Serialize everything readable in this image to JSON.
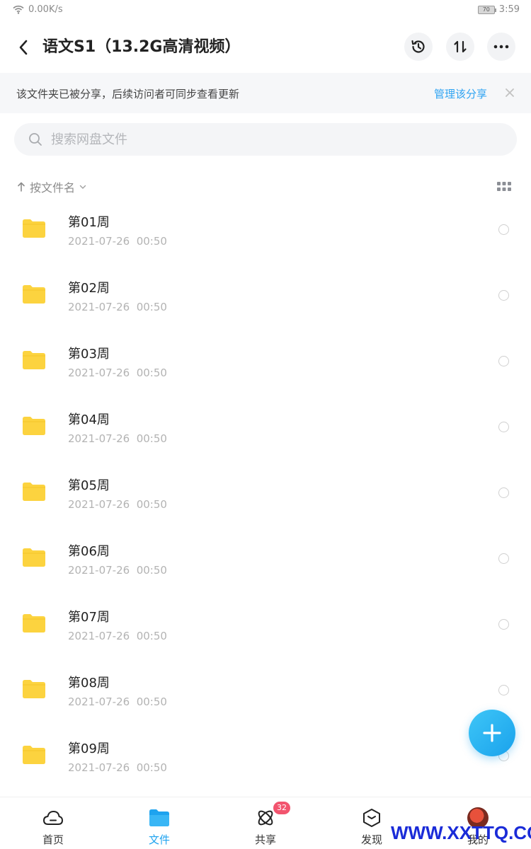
{
  "status_bar": {
    "network_speed": "0.00K/s",
    "battery": "70",
    "time": "3:59"
  },
  "header": {
    "title": "语文S1（13.2G高清视频）"
  },
  "share_notice": {
    "text": "该文件夹已被分享，后续访问者可同步查看更新",
    "manage_link": "管理该分享"
  },
  "search": {
    "placeholder": "搜索网盘文件"
  },
  "sort": {
    "label": "按文件名"
  },
  "files": [
    {
      "name": "第01周",
      "date": "2021-07-26  00:50"
    },
    {
      "name": "第02周",
      "date": "2021-07-26  00:50"
    },
    {
      "name": "第03周",
      "date": "2021-07-26  00:50"
    },
    {
      "name": "第04周",
      "date": "2021-07-26  00:50"
    },
    {
      "name": "第05周",
      "date": "2021-07-26  00:50"
    },
    {
      "name": "第06周",
      "date": "2021-07-26  00:50"
    },
    {
      "name": "第07周",
      "date": "2021-07-26  00:50"
    },
    {
      "name": "第08周",
      "date": "2021-07-26  00:50"
    },
    {
      "name": "第09周",
      "date": "2021-07-26  00:50"
    }
  ],
  "bottom_nav": [
    {
      "label": "首页",
      "icon": "cloud-icon"
    },
    {
      "label": "文件",
      "icon": "folder-icon",
      "active": true
    },
    {
      "label": "共享",
      "icon": "share-orbit-icon",
      "badge": "32"
    },
    {
      "label": "发现",
      "icon": "cube-icon"
    },
    {
      "label": "我的",
      "icon": "avatar"
    }
  ],
  "watermark": "WWW.XXTTQ.COM",
  "colors": {
    "accent": "#1ea3ef",
    "folder": "#fcd33f",
    "badge": "#f2546e"
  }
}
